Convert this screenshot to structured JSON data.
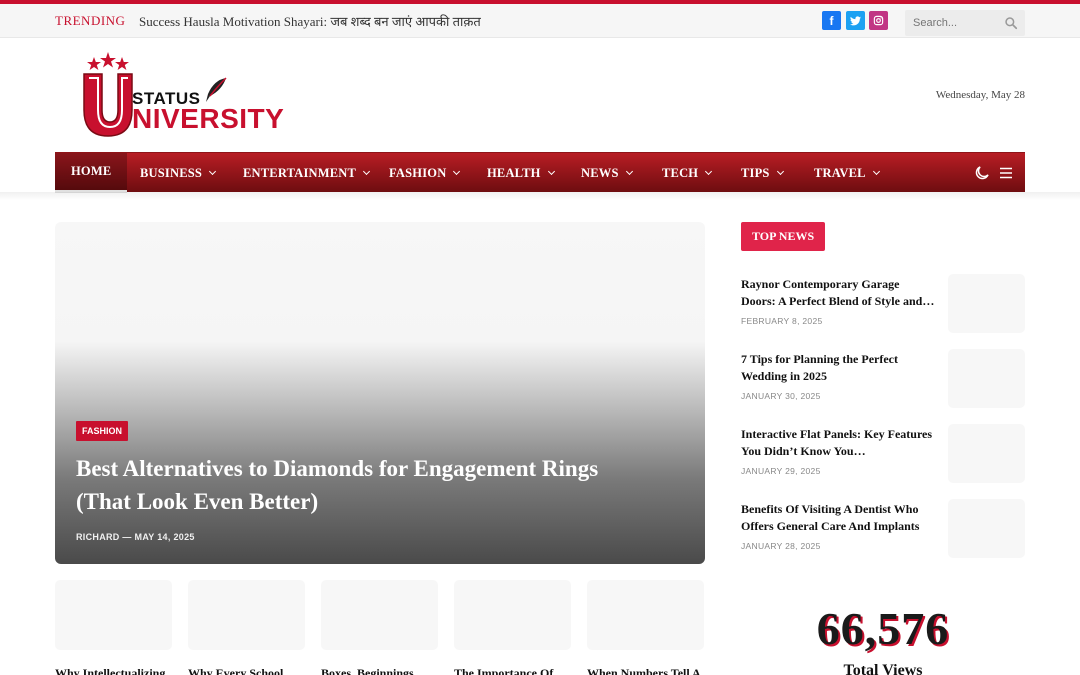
{
  "topbar": {
    "trending_label": "TRENDING",
    "trending_headline": "Success Hausla Motivation Shayari: जब शब्द बन जाएं आपकी ताक़त",
    "social": [
      "facebook-icon",
      "twitter-icon",
      "instagram-icon"
    ],
    "search_placeholder": "Search..."
  },
  "header": {
    "logo_top": "STATUS",
    "logo_bottom": "NIVERSITY",
    "logo_letter": "U",
    "date": "Wednesday, May 28"
  },
  "nav": {
    "items": [
      {
        "label": "HOME",
        "active": true,
        "dropdown": false
      },
      {
        "label": "BUSINESS",
        "dropdown": true
      },
      {
        "label": "ENTERTAINMENT",
        "dropdown": true
      },
      {
        "label": "FASHION",
        "dropdown": true
      },
      {
        "label": "HEALTH",
        "dropdown": true
      },
      {
        "label": "NEWS",
        "dropdown": true
      },
      {
        "label": "TECH",
        "dropdown": true
      },
      {
        "label": "TIPS",
        "dropdown": true
      },
      {
        "label": "TRAVEL",
        "dropdown": true
      }
    ]
  },
  "hero": {
    "category": "FASHION",
    "title": "Best Alternatives to Diamonds for Engagement Rings (That Look Even Better)",
    "author": "RICHARD",
    "date": "MAY 14, 2025"
  },
  "cards": [
    {
      "title": "Why Intellectualizing"
    },
    {
      "title": "Why Every School"
    },
    {
      "title": "Boxes, Beginnings,"
    },
    {
      "title": "The Importance Of"
    },
    {
      "title": "When Numbers Tell A"
    }
  ],
  "sidebar": {
    "label": "TOP NEWS",
    "items": [
      {
        "title": "Raynor Contemporary Garage Doors: A Perfect Blend of Style and…",
        "date": "FEBRUARY 8, 2025"
      },
      {
        "title": "7 Tips for Planning the Perfect Wedding in 2025",
        "date": "JANUARY 30, 2025"
      },
      {
        "title": "Interactive Flat Panels: Key Features You Didn’t Know You…",
        "date": "JANUARY 29, 2025"
      },
      {
        "title": "Benefits Of Visiting A Dentist Who Offers General Care And Implants",
        "date": "JANUARY 28, 2025"
      }
    ],
    "views_count": "66,576",
    "views_label": "Total Views"
  },
  "colors": {
    "brand_red": "#c8102e",
    "nav_dark": "#6e0d10",
    "top_news_pink": "#e0244a"
  }
}
